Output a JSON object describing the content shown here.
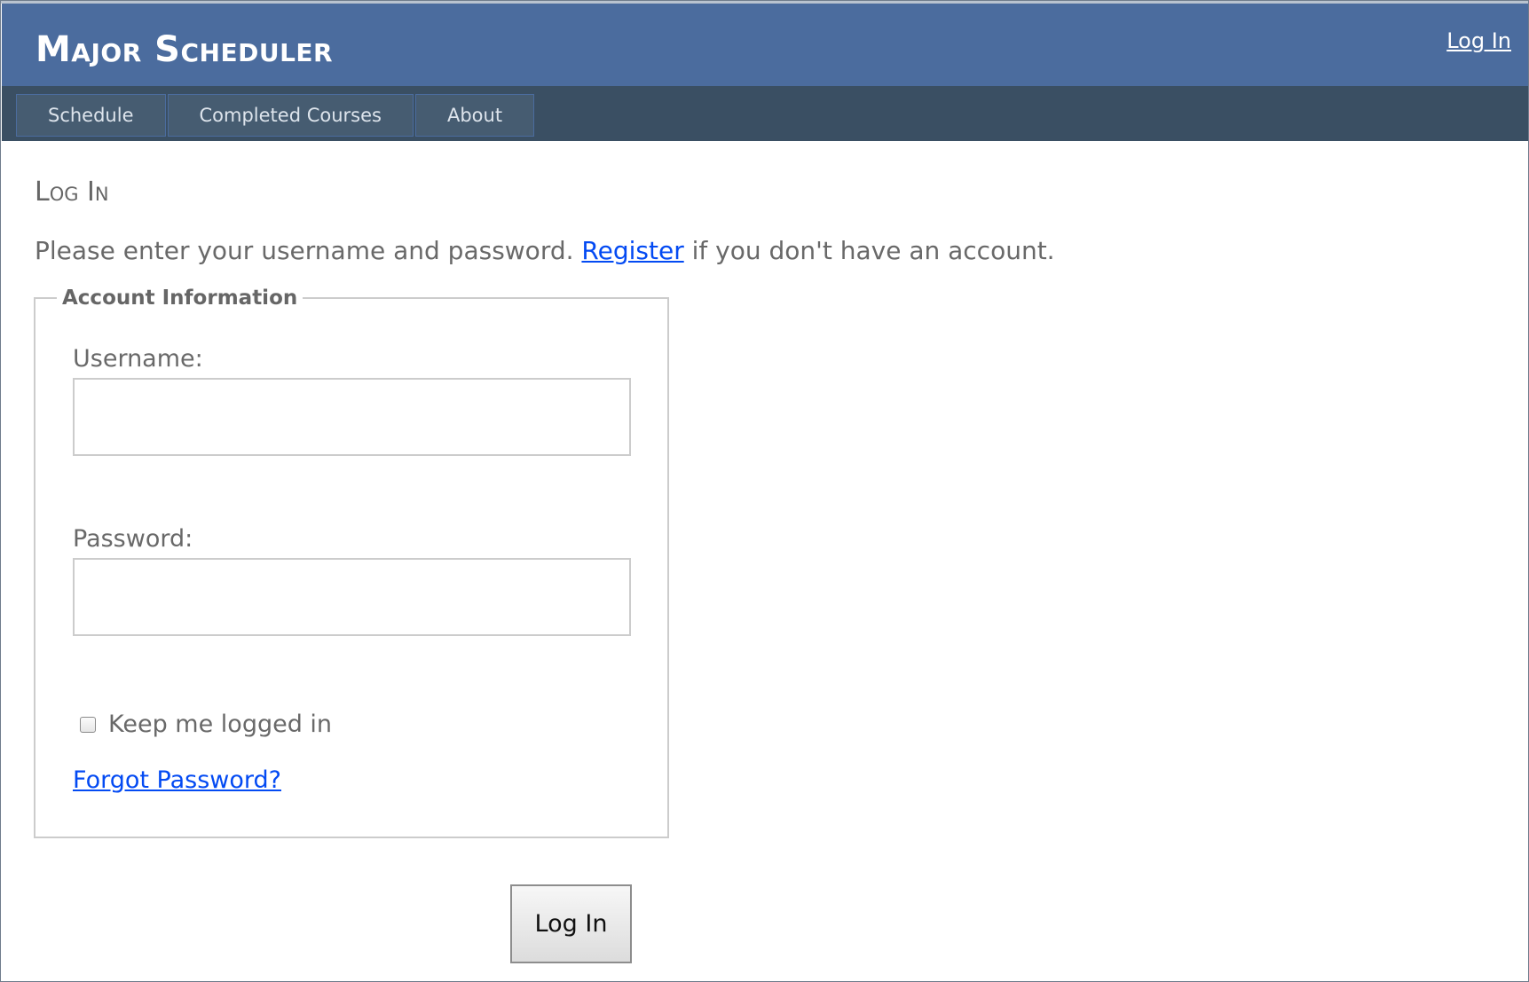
{
  "header": {
    "app_title": "Major Scheduler",
    "login_link": "Log In",
    "background_color": "#4b6c9e"
  },
  "nav": {
    "background_color": "#3a4f63",
    "items": [
      {
        "label": "Schedule"
      },
      {
        "label": "Completed Courses"
      },
      {
        "label": "About"
      }
    ]
  },
  "main": {
    "title": "Log In",
    "intro_before": "Please enter your username and password.",
    "register_link": "Register",
    "intro_after": "if you don't have an account.",
    "link_color": "#034af3"
  },
  "form": {
    "legend": "Account Information",
    "username_label": "Username:",
    "username_value": "",
    "password_label": "Password:",
    "password_value": "",
    "remember_label": "Keep me logged in",
    "remember_checked": false,
    "forgot_link": "Forgot Password?",
    "submit_label": "Log In"
  }
}
